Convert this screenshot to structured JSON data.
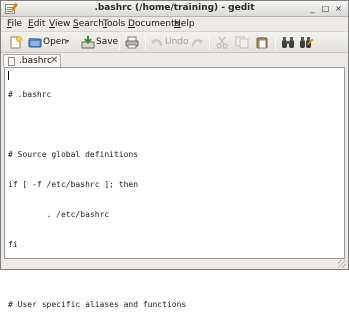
{
  "window": {
    "title": ".bashrc (/home/training) - gedit",
    "controls": {
      "minimize": "_",
      "maximize": "□",
      "close": "×"
    }
  },
  "menu": [
    {
      "mnemonic": "F",
      "rest": "ile"
    },
    {
      "mnemonic": "E",
      "rest": "dit"
    },
    {
      "mnemonic": "V",
      "rest": "iew"
    },
    {
      "mnemonic": "S",
      "rest": "earch"
    },
    {
      "mnemonic": "T",
      "rest": "ools"
    },
    {
      "mnemonic": "D",
      "rest": "ocuments"
    },
    {
      "mnemonic": "H",
      "rest": "elp"
    }
  ],
  "toolbar": {
    "open_label": "Open",
    "save_label": "Save",
    "undo_label": "Undo",
    "dropdown_arrow": "▾"
  },
  "tab": {
    "label": ".bashrc",
    "close": "✕"
  },
  "editor": {
    "lines": [
      "# .bashrc",
      "",
      "# Source global definitions",
      "if [ -f /etc/bashrc ]; then",
      "        . /etc/bashrc",
      "fi",
      "",
      "# User specific aliases and functions"
    ]
  },
  "colors": {
    "accent_open": "#3c6ea8",
    "accent_save": "#3a8a3a",
    "disabled": "#a7a39e"
  }
}
